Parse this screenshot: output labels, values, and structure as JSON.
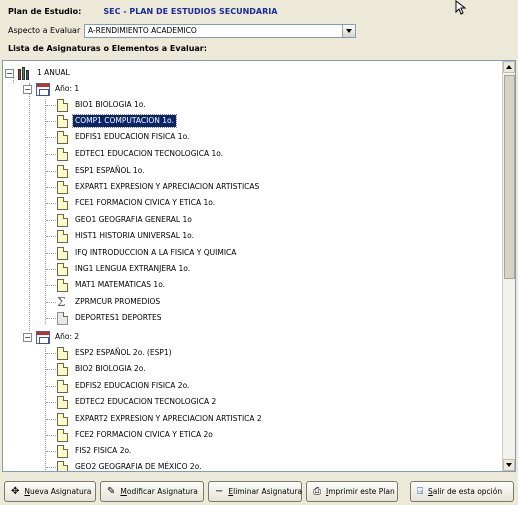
{
  "header": {
    "plan_label": "Plan de Estudio:",
    "plan_value": "SEC - PLAN DE ESTUDIOS SECUNDARIA",
    "aspect_label": "Aspecto a Evaluar",
    "aspect_value": "A-RENDIMIENTO ACADEMICO",
    "list_label": "Lista de Asignaturas o Elementos a Evaluar:"
  },
  "tree": {
    "root": "1 ANUAL",
    "years": [
      {
        "label": "Año: 1",
        "items": [
          {
            "text": "BIO1 BIOLOGIA 1o.",
            "icon": "document-icon"
          },
          {
            "text": "COMP1 COMPUTACION 1o.",
            "icon": "document-icon",
            "selected": true
          },
          {
            "text": "EDFIS1 EDUCACION FISICA 1o.",
            "icon": "document-icon"
          },
          {
            "text": "EDTEC1 EDUCACION TECNOLOGICA 1o.",
            "icon": "document-icon"
          },
          {
            "text": "ESP1 ESPAÑOL 1o.",
            "icon": "document-icon"
          },
          {
            "text": "EXPART1 EXPRESION Y APRECIACION ARTISTICAS",
            "icon": "document-icon"
          },
          {
            "text": "FCE1 FORMACION CIVICA Y ETICA 1o.",
            "icon": "document-icon"
          },
          {
            "text": "GEO1 GEOGRAFIA GENERAL 1o",
            "icon": "document-icon"
          },
          {
            "text": "HIST1 HISTORIA UNIVERSAL 1o.",
            "icon": "document-icon"
          },
          {
            "text": "IFQ INTRODUCCION A LA FISICA Y QUIMICA",
            "icon": "document-icon"
          },
          {
            "text": "ING1 LENGUA EXTRANJERA 1o.",
            "icon": "document-icon"
          },
          {
            "text": "MAT1 MATEMATICAS 1o.",
            "icon": "document-icon"
          },
          {
            "text": "ZPRMCUR PROMEDIOS",
            "icon": "sigma-icon"
          },
          {
            "text": "DEPORTES1 DEPORTES",
            "icon": "gray-document-icon"
          }
        ]
      },
      {
        "label": "Año: 2",
        "items": [
          {
            "text": "ESP2 ESPAÑOL 2o. (ESP1)",
            "icon": "document-icon"
          },
          {
            "text": "BIO2 BIOLOGIA 2o.",
            "icon": "document-icon"
          },
          {
            "text": "EDFIS2 EDUCACION FISICA 2o.",
            "icon": "document-icon"
          },
          {
            "text": "EDTEC2 EDUCACION TECNOLOGICA 2",
            "icon": "document-icon"
          },
          {
            "text": "EXPART2 EXPRESION Y APRECIACION ARTISTICA 2",
            "icon": "document-icon"
          },
          {
            "text": "FCE2 FORMACION CIVICA Y ETICA 2o",
            "icon": "document-icon"
          },
          {
            "text": "FIS2 FISICA 2o.",
            "icon": "document-icon"
          },
          {
            "text": "GEO2 GEOGRAFIA DE MÉXICO 2o.",
            "icon": "document-icon"
          }
        ]
      }
    ]
  },
  "buttons": {
    "new": "Nueva Asignatura",
    "modify": "Modificar Asignatura",
    "delete": "Eliminar Asignatura",
    "print": "Imprimir este Plan",
    "exit": "Salir de esta opción"
  },
  "colors": {
    "window_bg": "#ece9d8",
    "plan_value": "#1a2aa0",
    "selection": "#0a246a"
  }
}
